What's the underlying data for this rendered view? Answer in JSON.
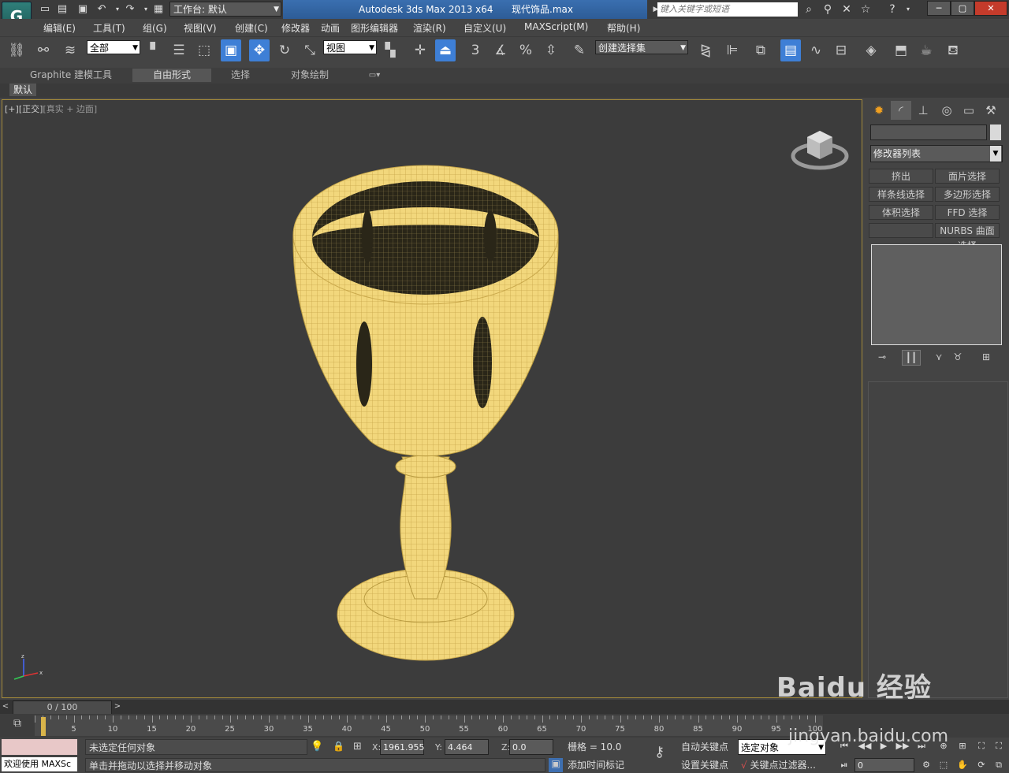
{
  "titlebar": {
    "workspace_label": "工作台: 默认",
    "app_title": "Autodesk 3ds Max  2013 x64",
    "file_name": "现代饰品.max",
    "search_placeholder": "键入关键字或短语"
  },
  "menu": [
    "编辑(E)",
    "工具(T)",
    "组(G)",
    "视图(V)",
    "创建(C)",
    "修改器",
    "动画",
    "图形编辑器",
    "渲染(R)",
    "自定义(U)",
    "MAXScript(M)",
    "帮助(H)"
  ],
  "toolbar": {
    "selection_filter": "全部",
    "ref_coord": "视图",
    "named_selection": "创建选择集",
    "snap_labels": [
      "3",
      "%"
    ]
  },
  "ribbon": {
    "tabs": [
      "Graphite 建模工具",
      "自由形式",
      "选择",
      "对象绘制"
    ],
    "active_tab": "自由形式",
    "sub_tab": "默认"
  },
  "viewport": {
    "label_plus": "[+]",
    "label_view": "[正交]",
    "label_shading": "[真实 + 边面]",
    "object_color": "#f2d77c",
    "axis": {
      "z": "z",
      "x": "x"
    }
  },
  "command_panel": {
    "modifier_list": "修改器列表",
    "modifier_buttons": [
      "挤出",
      "面片选择",
      "样条线选择",
      "多边形选择",
      "体积选择",
      "FFD 选择",
      "",
      "NURBS 曲面选择"
    ]
  },
  "timeline": {
    "frame_display": "0 / 100",
    "ticks": [
      0,
      5,
      10,
      15,
      20,
      25,
      30,
      35,
      40,
      45,
      50,
      55,
      60,
      65,
      70,
      75,
      80,
      85,
      90,
      95,
      100
    ],
    "current_frame": 0
  },
  "status": {
    "welcome": "欢迎使用 MAXSc",
    "selection_status": "未选定任何对象",
    "prompt": "单击并拖动以选择并移动对象",
    "x_label": "X:",
    "x_value": "1961.955",
    "y_label": "Y:",
    "y_value": "4.464",
    "z_label": "Z:",
    "z_value": "0.0",
    "grid": "栅格 = 10.0",
    "add_time_tag": "添加时间标记",
    "auto_key": "自动关键点",
    "set_key": "设置关键点",
    "selection_set": "选定对象",
    "key_filters": "关键点过滤器...",
    "frame_value": "0"
  },
  "watermark": {
    "line1": "Baidu 经验",
    "line2": "jingyan.baidu.com"
  }
}
